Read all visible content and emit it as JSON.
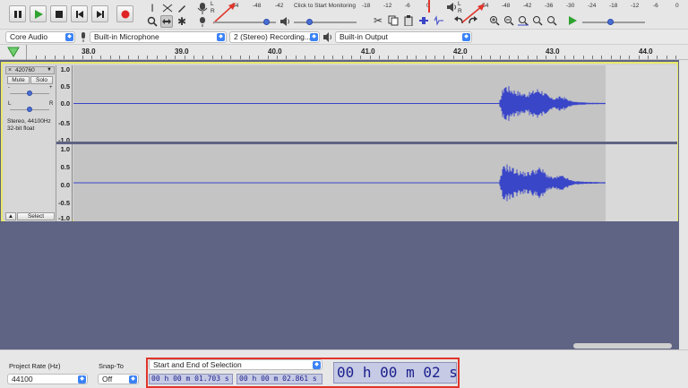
{
  "toolbar": {
    "transport": [
      "pause-icon",
      "play-icon",
      "stop-icon",
      "skip-start-icon",
      "skip-end-icon",
      "record-icon"
    ],
    "record_meter_label": "Click to Start Monitoring",
    "record_scale": [
      "-54",
      "-48",
      "-42",
      "-18",
      "-12",
      "-6",
      "0"
    ],
    "playback_scale": [
      "-54",
      "-48",
      "-42",
      "-36",
      "-30",
      "-24",
      "-18",
      "-12",
      "-6",
      "0"
    ],
    "lr_left": "L",
    "lr_right": "R"
  },
  "devices": {
    "host": "Core Audio",
    "input": "Built-in Microphone",
    "channels": "2 (Stereo) Recording...",
    "output": "Built-in Output"
  },
  "ruler": {
    "labels": [
      "38.0",
      "39.0",
      "40.0",
      "41.0",
      "42.0",
      "43.0",
      "44.0"
    ]
  },
  "track": {
    "name": "420760",
    "mute": "Mute",
    "solo": "Solo",
    "gain_min": "-",
    "gain_max": "+",
    "pan_left": "L",
    "pan_right": "R",
    "info_line1": "Stereo, 44100Hz",
    "info_line2": "32-bit float",
    "collapse": "▲",
    "select": "Select",
    "scale": [
      "1.0",
      "0.5",
      "0.0",
      "-0.5",
      "-1.0"
    ]
  },
  "bottom": {
    "project_rate_label": "Project Rate (Hz)",
    "project_rate_value": "44100",
    "snap_to_label": "Snap-To",
    "snap_to_value": "Off",
    "selection_mode": "Start and End of Selection",
    "selection_start": "00 h 00 m 01.703 s",
    "selection_end": "00 h 00 m 02.861 s",
    "audio_position": "00 h 00 m 02 s"
  },
  "colors": {
    "accent": "#3b82f6",
    "waveform": "#3a46c8",
    "selection_highlight": "#e0352b",
    "track_focus": "#e8e86a"
  }
}
